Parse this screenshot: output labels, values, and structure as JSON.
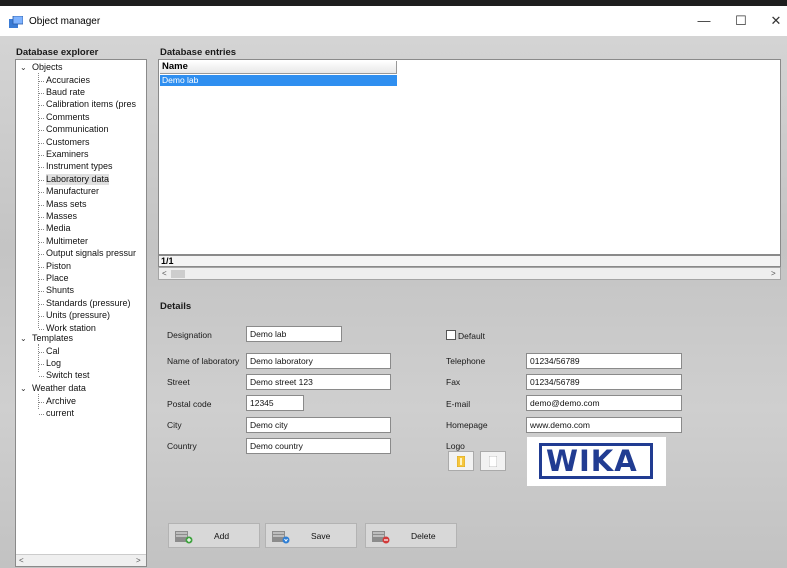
{
  "window": {
    "title": "Object manager",
    "minimize": "—",
    "maximize": "☐",
    "close": "✕"
  },
  "explorer": {
    "label": "Database explorer",
    "root_objects": "Objects",
    "objects": [
      "Accuracies",
      "Baud rate",
      "Calibration items (pres",
      "Comments",
      "Communication",
      "Customers",
      "Examiners",
      "Instrument types",
      "Laboratory data",
      "Manufacturer",
      "Mass sets",
      "Masses",
      "Media",
      "Multimeter",
      "Output signals pressur",
      "Piston",
      "Place",
      "Shunts",
      "Standards (pressure)",
      "Units (pressure)",
      "Work station"
    ],
    "root_templates": "Templates",
    "templates": [
      "Cal",
      "Log",
      "Switch test"
    ],
    "root_weather": "Weather data",
    "weather": [
      "Archive",
      "current"
    ],
    "scroll_left": "<",
    "scroll_right": ">"
  },
  "entries": {
    "label": "Database entries",
    "column_name": "Name",
    "rows": [
      "Demo lab"
    ],
    "count": "1/1",
    "scroll_left": "<",
    "scroll_right": ">"
  },
  "details": {
    "label": "Details",
    "designation_label": "Designation",
    "designation": "Demo lab",
    "default_label": "Default",
    "name_label": "Name of laboratory",
    "name": "Demo laboratory",
    "street_label": "Street",
    "street": "Demo street 123",
    "postal_label": "Postal code",
    "postal": "12345",
    "city_label": "City",
    "city": "Demo city",
    "country_label": "Country",
    "country": "Demo country",
    "telephone_label": "Telephone",
    "telephone": "01234/56789",
    "fax_label": "Fax",
    "fax": "01234/56789",
    "email_label": "E-mail",
    "email": "demo@demo.com",
    "homepage_label": "Homepage",
    "homepage": "www.demo.com",
    "logo_label": "Logo",
    "logo_text": "WIKA"
  },
  "actions": {
    "add": "Add",
    "save": "Save",
    "delete": "Delete"
  },
  "colors": {
    "selection": "#2f8ff0",
    "wika_blue": "#213c92"
  }
}
